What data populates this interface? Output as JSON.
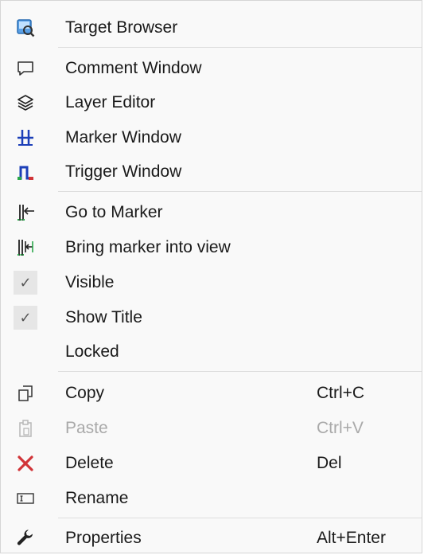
{
  "menu": {
    "items": [
      {
        "label": "Target Browser",
        "icon": "target-browser-icon"
      },
      {
        "label": "Comment Window",
        "icon": "comment-icon"
      },
      {
        "label": "Layer Editor",
        "icon": "layers-icon"
      },
      {
        "label": "Marker Window",
        "icon": "marker-window-icon"
      },
      {
        "label": "Trigger Window",
        "icon": "trigger-window-icon"
      },
      {
        "label": "Go to Marker",
        "icon": "go-to-marker-icon"
      },
      {
        "label": "Bring marker into view",
        "icon": "bring-marker-icon"
      },
      {
        "label": "Visible",
        "checked": true,
        "check_glyph": "✓"
      },
      {
        "label": "Show Title",
        "checked": true,
        "check_glyph": "✓"
      },
      {
        "label": "Locked",
        "checked": false
      },
      {
        "label": "Copy",
        "shortcut": "Ctrl+C",
        "icon": "copy-icon"
      },
      {
        "label": "Paste",
        "shortcut": "Ctrl+V",
        "icon": "paste-icon",
        "disabled": true
      },
      {
        "label": "Delete",
        "shortcut": "Del",
        "icon": "delete-icon"
      },
      {
        "label": "Rename",
        "icon": "rename-icon"
      },
      {
        "label": "Properties",
        "shortcut": "Alt+Enter",
        "icon": "wrench-icon"
      }
    ]
  },
  "colors": {
    "menu_background": "#f9f9f9",
    "separator": "#dedede",
    "text": "#1a1a1a",
    "disabled_text": "#a9a9a9",
    "delete_icon": "#d13438",
    "marker_icon": "#1c3fb8"
  }
}
